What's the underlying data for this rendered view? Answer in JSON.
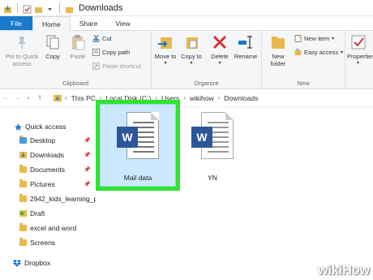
{
  "window": {
    "title": "Downloads"
  },
  "tabs": [
    "File",
    "Home",
    "Share",
    "View"
  ],
  "ribbon": {
    "clipboard": {
      "label": "Clipboard",
      "pin": "Pin to Quick access",
      "copy": "Copy",
      "paste": "Paste",
      "cut": "Cut",
      "copy_path": "Copy path",
      "paste_shortcut": "Paste shortcut"
    },
    "organize": {
      "label": "Organize",
      "move_to": "Move to",
      "copy_to": "Copy to",
      "delete": "Delete",
      "rename": "Rename"
    },
    "new": {
      "label": "New",
      "new_folder": "New folder",
      "new_item": "New item",
      "easy_access": "Easy access"
    },
    "open": {
      "properties": "Properties"
    }
  },
  "address": {
    "crumbs": [
      "This PC",
      "Local Disk (C:)",
      "Users",
      "wikihow",
      "Downloads"
    ]
  },
  "nav": {
    "items": [
      {
        "label": "Quick access",
        "icon": "star-icon",
        "pinned": false
      },
      {
        "label": "Desktop",
        "icon": "folder-icon",
        "pinned": true
      },
      {
        "label": "Downloads",
        "icon": "download-folder-icon",
        "pinned": true
      },
      {
        "label": "Documents",
        "icon": "folder-icon",
        "pinned": true
      },
      {
        "label": "Pictures",
        "icon": "folder-icon",
        "pinned": true
      },
      {
        "label": "2942_kids_learning_p",
        "icon": "folder-icon",
        "pinned": false
      },
      {
        "label": "Draft",
        "icon": "folder-icon",
        "pinned": false
      },
      {
        "label": "excel and word",
        "icon": "folder-icon",
        "pinned": false
      },
      {
        "label": "Screens",
        "icon": "folder-icon",
        "pinned": false
      },
      {
        "label": "Dropbox",
        "icon": "dropbox-icon",
        "pinned": false
      }
    ]
  },
  "files": [
    {
      "name": "Mail data",
      "selected": true
    },
    {
      "name": "YN",
      "selected": false
    }
  ],
  "colors": {
    "accent": "#1979ca",
    "highlight": "#2ee52e",
    "selection": "#cce8ff",
    "word": "#2b579a"
  },
  "watermark": {
    "wiki": "wiki",
    "how": "How"
  }
}
